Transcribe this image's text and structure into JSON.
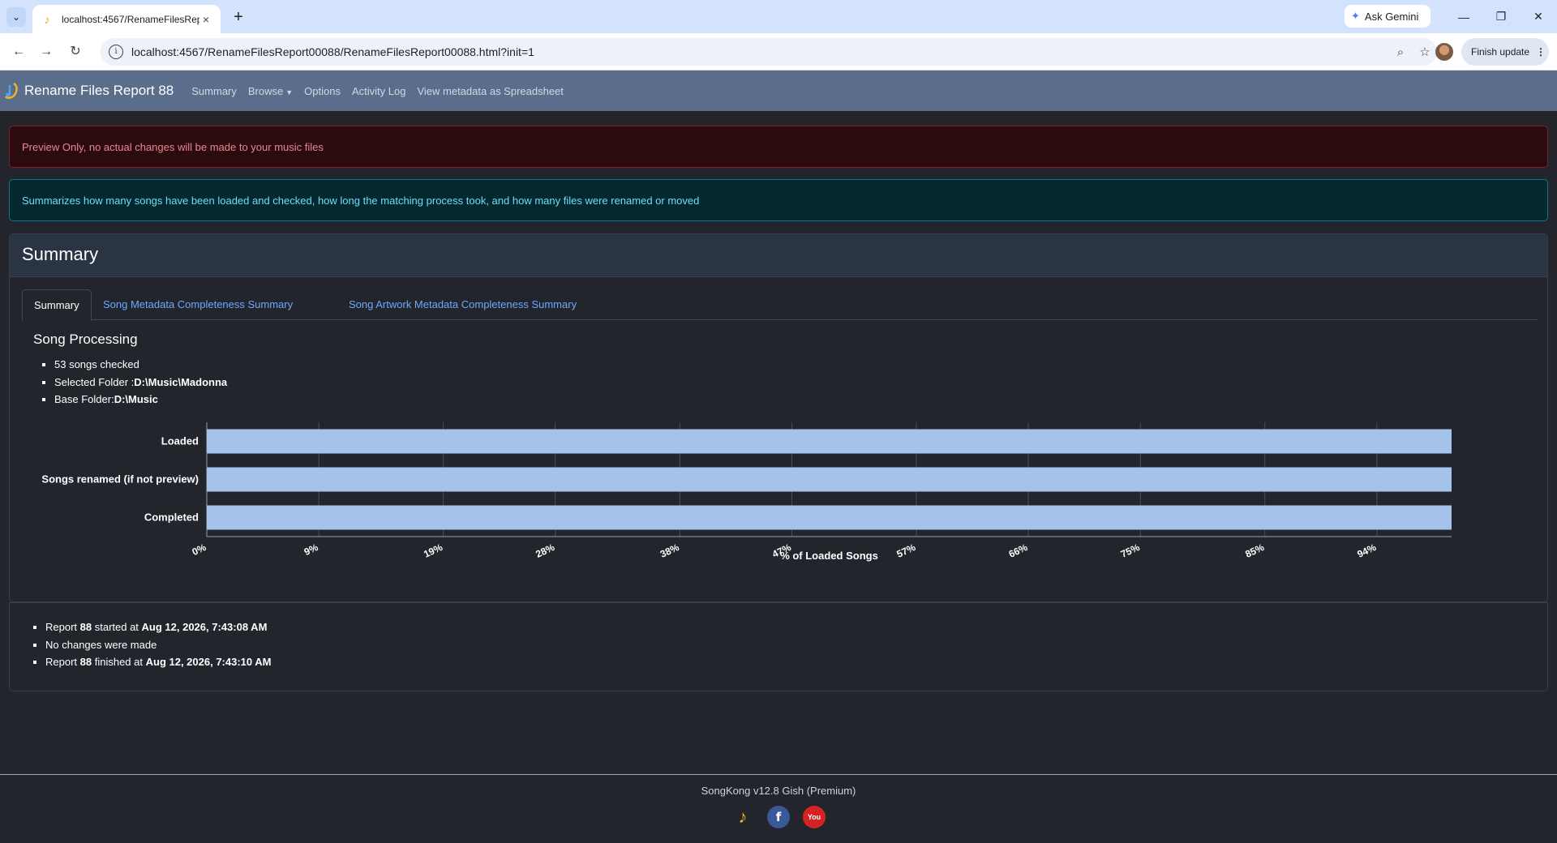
{
  "browser": {
    "tab_title": "localhost:4567/RenameFilesRep",
    "url": "localhost:4567/RenameFilesReport00088/RenameFilesReport00088.html?init=1",
    "ask_gemini": "Ask Gemini",
    "finish_update": "Finish update"
  },
  "nav": {
    "brand": "Rename Files Report 88",
    "links": [
      "Summary",
      "Browse",
      "Options",
      "Activity Log",
      "View metadata as Spreadsheet"
    ]
  },
  "alerts": {
    "preview": "Preview Only, no actual changes will be made to your music files",
    "info": "Summarizes how many songs have been loaded and checked, how long the matching process took, and how many files were renamed or moved"
  },
  "card": {
    "title": "Summary",
    "tabs": [
      "Summary",
      "Song Metadata Completeness Summary",
      "Song Artwork Metadata Completeness Summary"
    ],
    "processing_title": "Song Processing",
    "songs_checked": "53 songs checked",
    "selected_folder_label": "Selected Folder :",
    "selected_folder_value": "D:\\Music\\Madonna",
    "base_folder_label": "Base Folder:",
    "base_folder_value": "D:\\Music"
  },
  "chart_data": {
    "type": "bar",
    "orientation": "horizontal",
    "categories": [
      "Loaded",
      "Songs renamed (if not preview)",
      "Completed"
    ],
    "values": [
      100,
      100,
      100
    ],
    "xlabel": "% of Loaded Songs",
    "ylabel": "",
    "xticks": [
      "0%",
      "9%",
      "19%",
      "28%",
      "38%",
      "47%",
      "57%",
      "66%",
      "75%",
      "85%",
      "94%"
    ],
    "xlim": [
      0,
      100
    ],
    "bar_color": "#a4c2ea",
    "grid": true
  },
  "report": {
    "items": [
      {
        "prefix": "Report ",
        "bold1": "88",
        "mid": " started at ",
        "bold2": "Aug 12, 2026, 7:43:08 AM"
      },
      {
        "prefix": "No changes were made",
        "bold1": "",
        "mid": "",
        "bold2": ""
      },
      {
        "prefix": "Report ",
        "bold1": "88",
        "mid": " finished at ",
        "bold2": "Aug 12, 2026, 7:43:10 AM"
      }
    ]
  },
  "footer": {
    "version": "SongKong v12.8 Gish (Premium)",
    "facebook_glyph": "f",
    "youtube_glyph": "You"
  }
}
